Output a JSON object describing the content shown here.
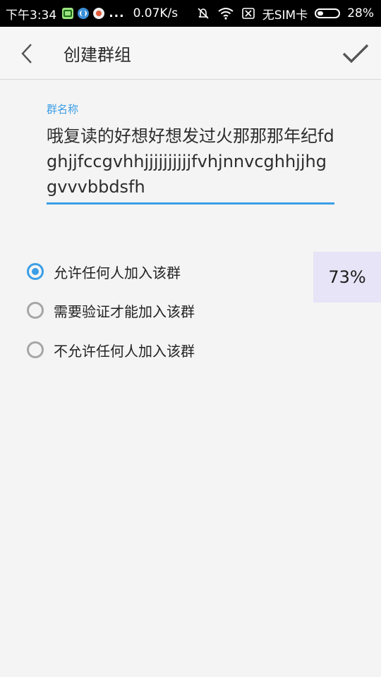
{
  "status_bar": {
    "time": "下午3:34",
    "dots": "...",
    "net_speed": "0.07K/s",
    "sim": "无SIM卡",
    "battery": "28%",
    "battery_level": 0.28
  },
  "header": {
    "title": "创建群组",
    "back_icon": "chevron-left-icon",
    "confirm_icon": "checkmark-icon"
  },
  "form": {
    "name_label": "群名称",
    "name_value": "哦复读的好想好想发过火那那那年纪fdghjjfccgvhhjjjjjjjjjjfvhjnnvcghhjjhggvvvbbdsfh"
  },
  "options": [
    {
      "label": "允许任何人加入该群",
      "checked": true
    },
    {
      "label": "需要验证才能加入该群",
      "checked": false
    },
    {
      "label": "不允许任何人加入该群",
      "checked": false
    }
  ],
  "badge": {
    "text": "73%"
  },
  "colors": {
    "accent": "#3a9ee6",
    "background": "#f4f4f4",
    "status_bar": "#000000",
    "badge_bg": "#e6e4f6"
  }
}
